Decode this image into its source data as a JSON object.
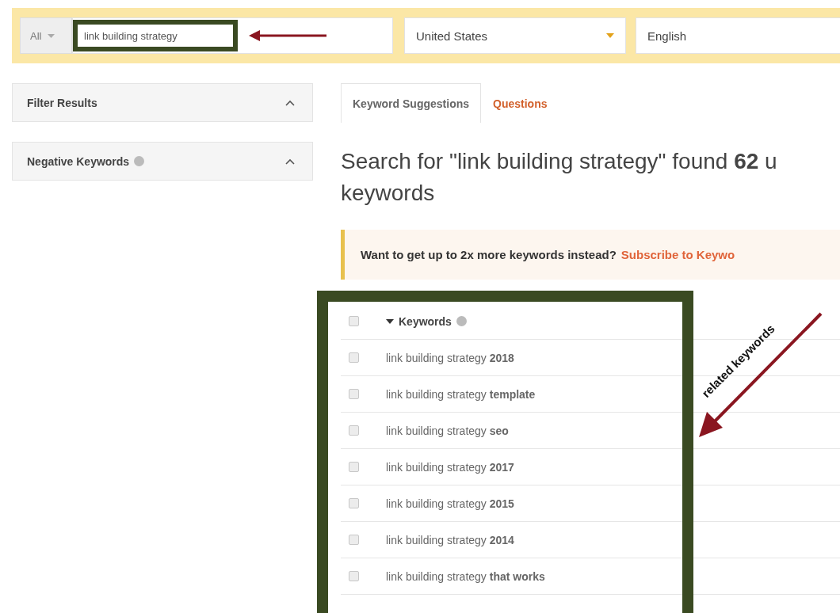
{
  "search_bar": {
    "scope": "All",
    "query": "link building strategy",
    "country": "United States",
    "language": "English"
  },
  "sidebar": [
    {
      "title": "Filter Results",
      "help": false,
      "expanded": true
    },
    {
      "title": "Negative Keywords",
      "help": true,
      "expanded": true
    }
  ],
  "tabs": [
    {
      "label": "Keyword Suggestions",
      "selected": true
    },
    {
      "label": "Questions",
      "selected": false
    }
  ],
  "heading_lines": [
    "Search for \"link building strategy\" found **62** u",
    "keywords"
  ],
  "notice": {
    "text": "Want to get up to 2x more keywords instead?",
    "link": "Subscribe to Keywo"
  },
  "table": {
    "column": "Keywords",
    "header_checked": false,
    "rows": [
      {
        "keyword": "link building strategy **2018**",
        "checked": false
      },
      {
        "keyword": "link building strategy **template**",
        "checked": false
      },
      {
        "keyword": "link building strategy **seo**",
        "checked": false
      },
      {
        "keyword": "link building strategy **2017**",
        "checked": false
      },
      {
        "keyword": "link building strategy **2015**",
        "checked": false
      },
      {
        "keyword": "link building strategy **2014**",
        "checked": false
      },
      {
        "keyword": "link building strategy **that works**",
        "checked": false
      }
    ]
  },
  "annotation": {
    "label": "related keywords"
  }
}
